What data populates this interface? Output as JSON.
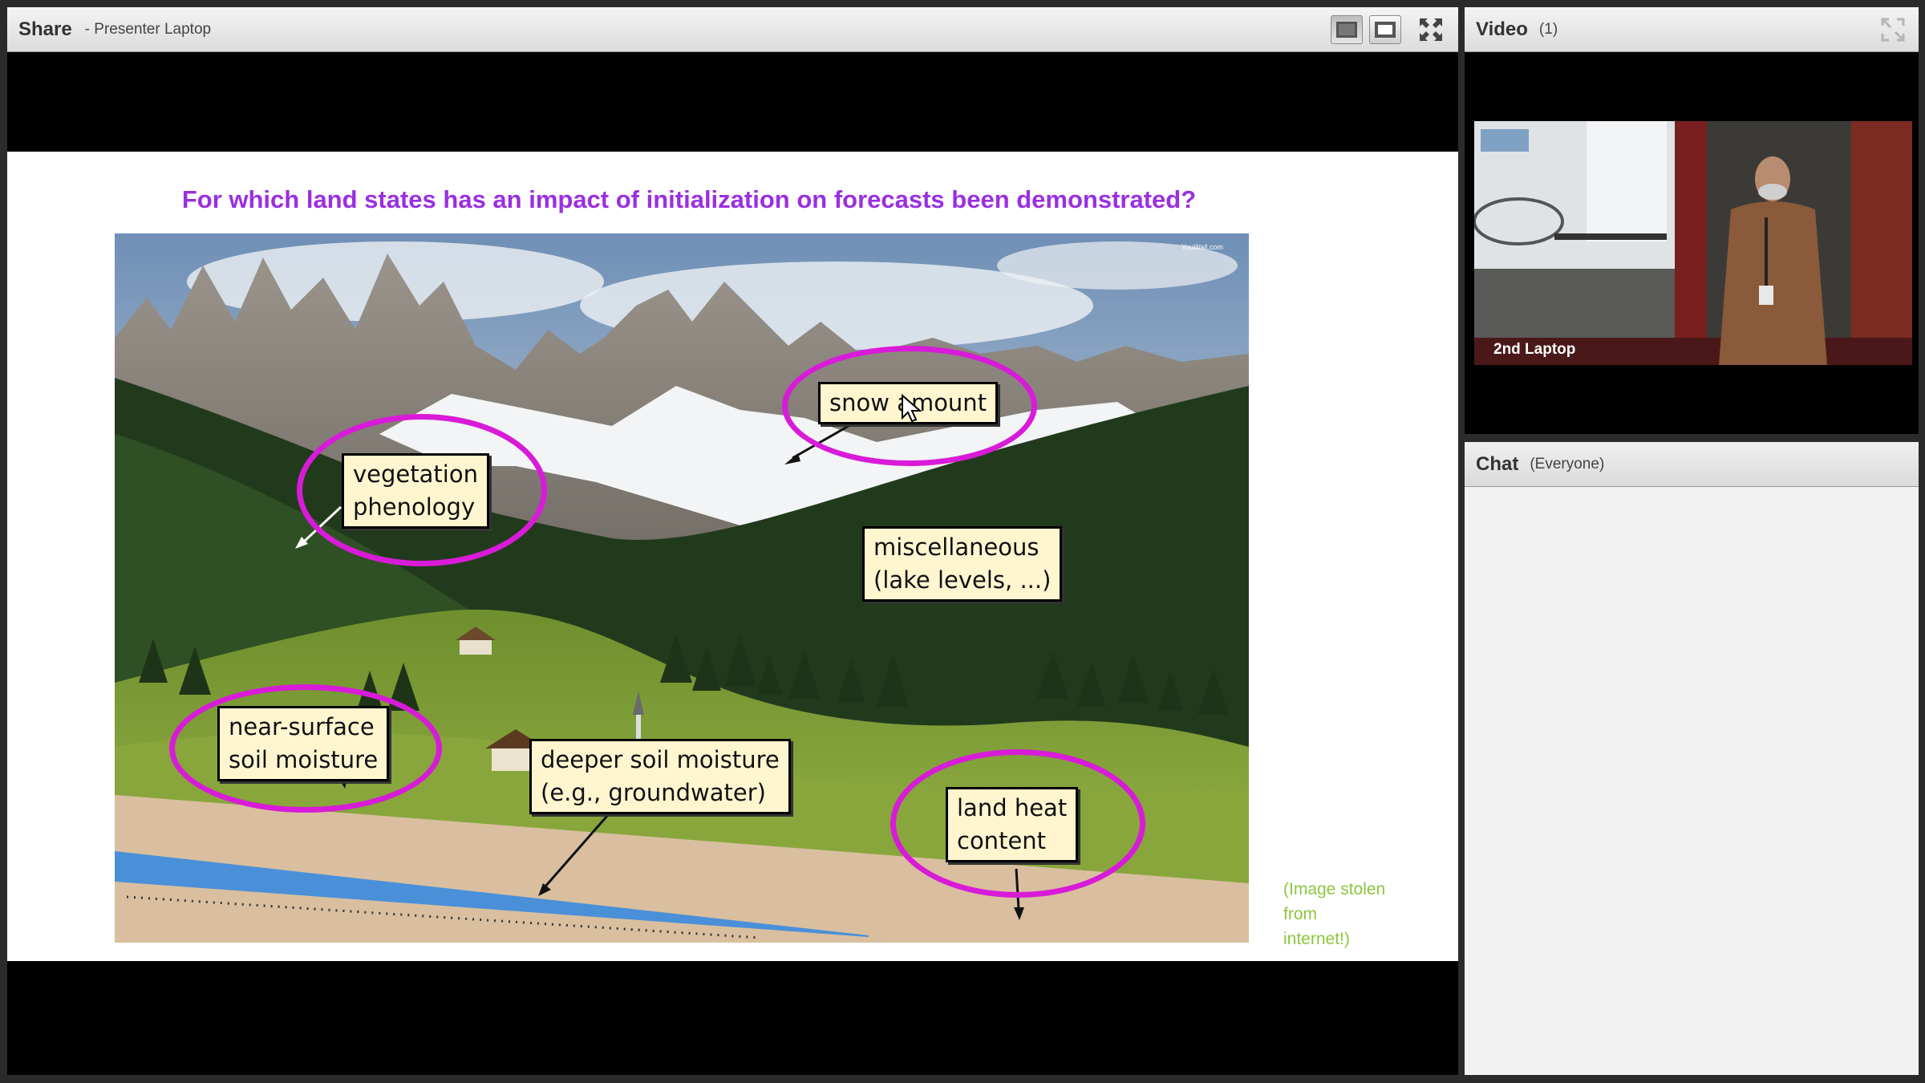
{
  "share_pod": {
    "title": "Share",
    "subtitle": "- Presenter Laptop",
    "controls": [
      "normal-view-icon",
      "fit-view-icon",
      "fullscreen-icon"
    ]
  },
  "slide": {
    "title": "For which land states has an impact of initialization on forecasts been demonstrated?",
    "photo_watermark": "YouWall.com",
    "labels": {
      "snow": "snow amount",
      "vegetation_1": "vegetation",
      "vegetation_2": "phenology",
      "misc_1": "miscellaneous",
      "misc_2": "(lake levels, ...)",
      "near_surface_1": "near-surface",
      "near_surface_2": "soil moisture",
      "deeper_1": "deeper soil moisture",
      "deeper_2": "(e.g., groundwater)",
      "heat_1": "land heat",
      "heat_2": "content"
    },
    "credit_lines": [
      "(Image stolen",
      "from",
      "internet!)"
    ],
    "colors": {
      "title": "#9b2fe0",
      "oval": "#d81bd8",
      "label_bg": "#fff6d0",
      "credit": "#8cc63f",
      "groundwater": "#4a90d9"
    }
  },
  "video_pod": {
    "title": "Video",
    "count": "(1)",
    "camera_label": "2nd Laptop"
  },
  "chat_pod": {
    "title": "Chat",
    "audience": "(Everyone)"
  }
}
